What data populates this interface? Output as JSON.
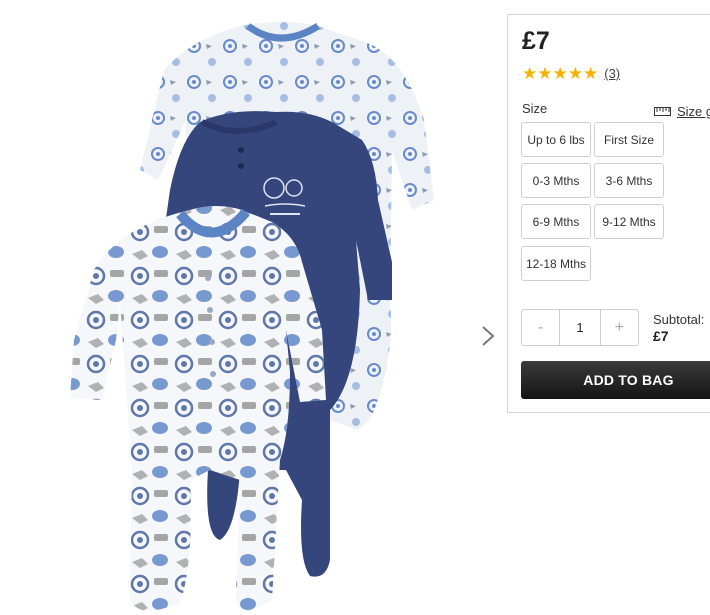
{
  "product": {
    "image_alt": "Baby sleepsuits 3 pack"
  },
  "price": "£7",
  "rating": {
    "stars": 5,
    "review_count": "(3)",
    "star_color": "#f5b301"
  },
  "size": {
    "label": "Size",
    "guide_label": "Size g",
    "options": [
      "Up to 6 lbs",
      "First Size",
      "0-3 Mths",
      "3-6 Mths",
      "6-9 Mths",
      "9-12 Mths",
      "12-18 Mths"
    ]
  },
  "quantity": {
    "minus": "-",
    "value": "1",
    "plus": "+"
  },
  "subtotal": {
    "label": "Subtotal:",
    "value": "£7"
  },
  "add_to_bag_label": "ADD TO BAG",
  "colors": {
    "navy": "#2e3d6e",
    "trim_blue": "#5b84c4"
  }
}
